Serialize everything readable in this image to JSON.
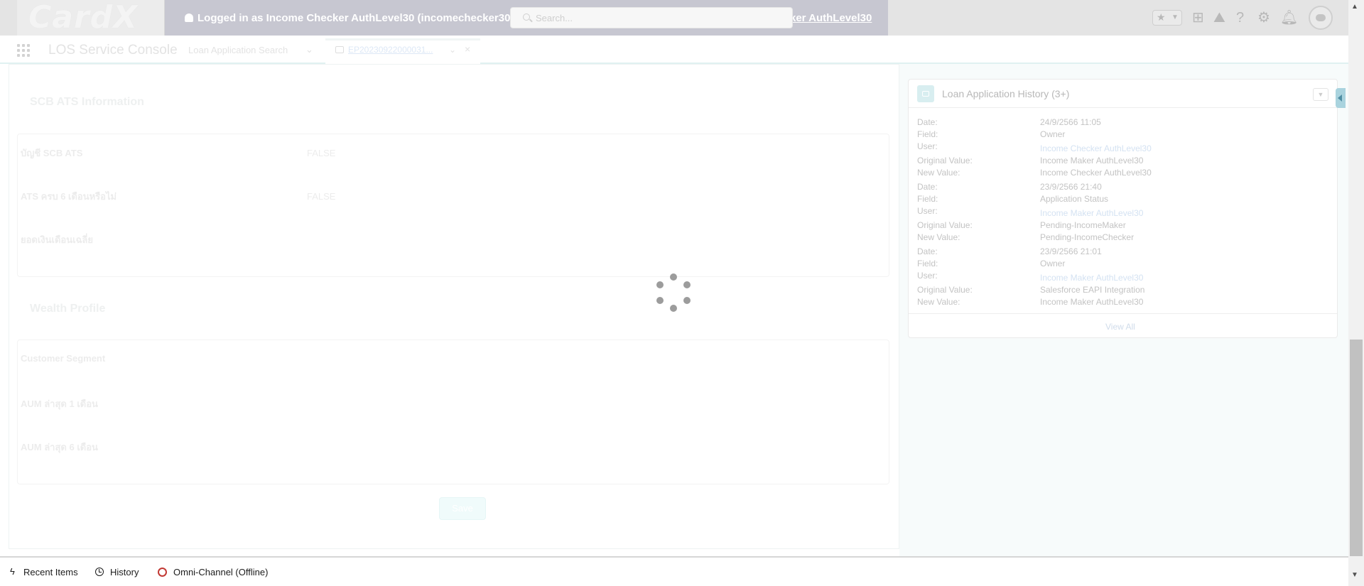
{
  "header": {
    "logo_text": "CardX",
    "login_banner": "Logged in as Income Checker AuthLevel30 (incomechecker30@",
    "login_banner_tail": "ker AuthLevel30",
    "search_placeholder": "Search..."
  },
  "nav": {
    "app_name": "LOS Service Console",
    "item": "Loan Application Search",
    "tab_label": "EP20230922000031..."
  },
  "main": {
    "section_ats": {
      "title": "SCB ATS Information",
      "fields": [
        {
          "label": "บัญชี SCB ATS",
          "value": "FALSE"
        },
        {
          "label": "ATS ครบ 6 เดือนหรือไม่",
          "value": "FALSE"
        },
        {
          "label": "ยอดเงินเดือนเฉลี่ย",
          "value": ""
        }
      ]
    },
    "section_wealth": {
      "title": "Wealth Profile",
      "fields": [
        {
          "label": "Customer Segment",
          "value": ""
        },
        {
          "label": "AUM ล่าสุด 1 เดือน",
          "value": ""
        },
        {
          "label": "AUM ล่าสุด 6 เดือน",
          "value": ""
        }
      ]
    },
    "save_label": "Save"
  },
  "history": {
    "title": "Loan Application History (3+)",
    "labels": {
      "date": "Date:",
      "field": "Field:",
      "user": "User:",
      "original": "Original Value:",
      "new": "New Value:"
    },
    "entries": [
      {
        "date": "24/9/2566 11:05",
        "field": "Owner",
        "user": "Income Checker AuthLevel30",
        "original": "Income Maker AuthLevel30",
        "new": "Income Checker AuthLevel30"
      },
      {
        "date": "23/9/2566 21:40",
        "field": "Application Status",
        "user": "Income Maker AuthLevel30",
        "original": "Pending-IncomeMaker",
        "new": "Pending-IncomeChecker"
      },
      {
        "date": "23/9/2566 21:01",
        "field": "Owner",
        "user": "Income Maker AuthLevel30",
        "original": "Salesforce EAPI Integration",
        "new": "Income Maker AuthLevel30"
      }
    ],
    "view_all": "View All"
  },
  "utility_bar": {
    "recent_items": "Recent Items",
    "history": "History",
    "omni_channel": "Omni-Channel (Offline)"
  },
  "colors": {
    "login_banner": "#c7c7d1",
    "omni_offline": "#c23934",
    "history_icon": "#d8eef0"
  }
}
